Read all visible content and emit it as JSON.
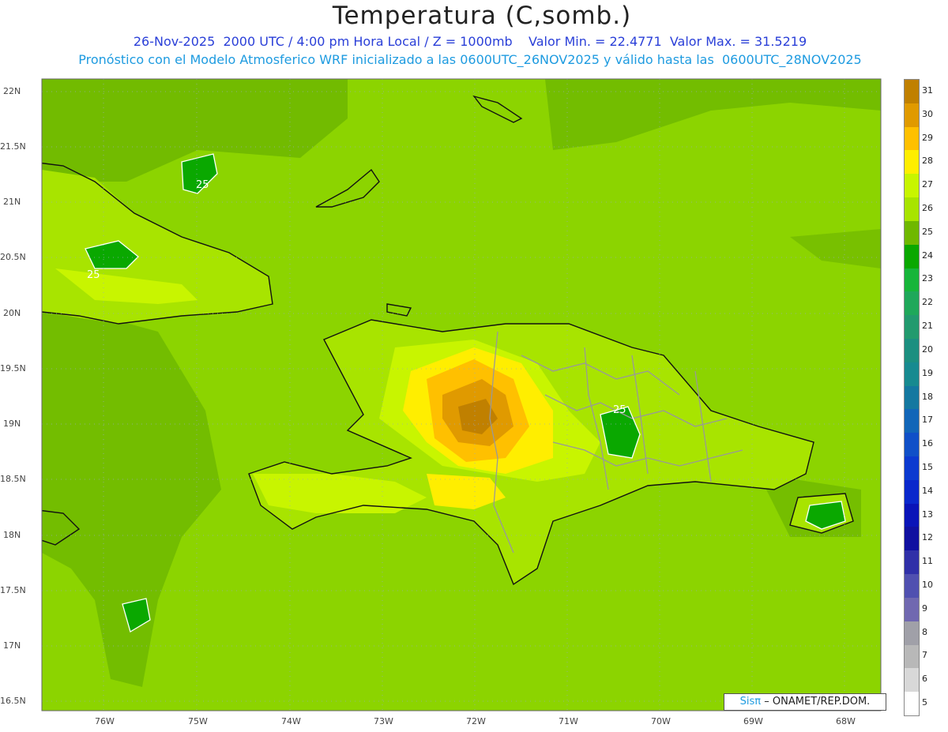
{
  "header": {
    "title": "Temperatura (C,somb.)",
    "line1": "26-Nov-2025  2000 UTC / 4:00 pm Hora Local / Z = 1000mb    Valor Min. = 22.4771  Valor Max. = 31.5219",
    "line2": "Pronóstico con el Modelo Atmosferico WRF inicializado a las 0600UTC_26NOV2025 y válido hasta las  0600UTC_28NOV2025"
  },
  "axes": {
    "lat_labels": [
      "22N",
      "21.5N",
      "21N",
      "20.5N",
      "20N",
      "19.5N",
      "19N",
      "18.5N",
      "18N",
      "17.5N",
      "17N",
      "16.5N"
    ],
    "lon_labels": [
      "76W",
      "75W",
      "74W",
      "73W",
      "72W",
      "71W",
      "70W",
      "69W",
      "68W"
    ]
  },
  "contour_labels": [
    "25",
    "25",
    "25"
  ],
  "colorbar": {
    "levels": [
      "31",
      "30",
      "29",
      "28",
      "27",
      "26",
      "25",
      "24",
      "23",
      "22",
      "21",
      "20",
      "19",
      "18",
      "17",
      "16",
      "15",
      "14",
      "13",
      "12",
      "11",
      "10",
      "9",
      "8",
      "7",
      "6",
      "5"
    ],
    "colors": [
      "#c08000",
      "#e09a00",
      "#ffc000",
      "#ffee00",
      "#c8f500",
      "#a8e400",
      "#6fb800",
      "#0aa800",
      "#17b53a",
      "#1fa85a",
      "#229a6e",
      "#1c8f80",
      "#178a90",
      "#1478a0",
      "#1266b8",
      "#1050c8",
      "#0c3ad0",
      "#0a28cc",
      "#0a14b8",
      "#1010a0",
      "#3030a8",
      "#5050b0",
      "#7068b0",
      "#a0a0a8",
      "#b8b8b8",
      "#d8d8d8",
      "#ffffff"
    ]
  },
  "credit": {
    "logo": "Sisπ",
    "text": "– ONAMET/REP.DOM."
  }
}
